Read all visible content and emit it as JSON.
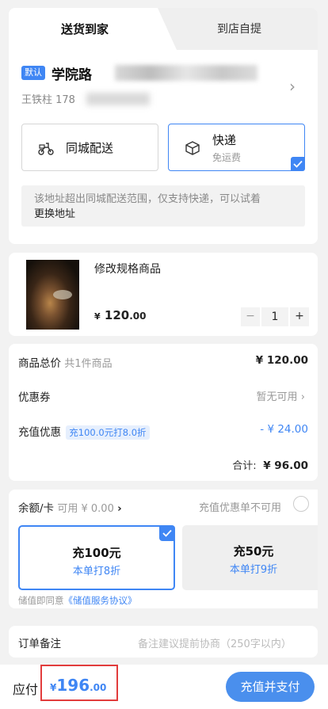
{
  "tabs": {
    "delivery": "送货到家",
    "pickup": "到店自提"
  },
  "address": {
    "badge": "默认",
    "street": "学院路",
    "contact": "王铁柱 178"
  },
  "shipping": {
    "local": {
      "title": "同城配送"
    },
    "express": {
      "title": "快递",
      "subtitle": "免运费"
    },
    "notice": "该地址超出同城配送范围，仅支持快递，可以试着",
    "notice_link": "更换地址"
  },
  "product": {
    "name": "修改规格商品",
    "price_symbol": "¥",
    "price_int": "120",
    "price_dec": ".00",
    "quantity": "1",
    "minus": "−",
    "plus": "+"
  },
  "summary": {
    "total_label": "商品总价",
    "total_count": "共1件商品",
    "total_value": "¥ 120.00",
    "coupon_label": "优惠券",
    "coupon_value": "暂无可用",
    "recharge_label": "充值优惠",
    "recharge_tag": "充100.0元打8.0折",
    "recharge_value": "- ¥ 24.00",
    "sum_label": "合计:",
    "sum_value": "¥ 96.00"
  },
  "balance": {
    "label": "余额/卡",
    "available": "可用 ¥ 0.00",
    "toggle_label": "充值优惠单不可用",
    "options": [
      {
        "title": "充100元",
        "sub": "本单打8折"
      },
      {
        "title": "充50元",
        "sub": "本单打9折"
      }
    ],
    "agreement_prefix": "储值即同意",
    "agreement_link": "《储值服务协议》"
  },
  "remark": {
    "label": "订单备注",
    "placeholder": "备注建议提前协商（250字以内）"
  },
  "footer": {
    "due_label": "应付",
    "symbol": "¥",
    "amount_int": "196",
    "amount_dec": ".00",
    "pay_button": "充值并支付"
  },
  "colors": {
    "accent": "#3f86f4",
    "highlight_box": "#e23c3c"
  }
}
